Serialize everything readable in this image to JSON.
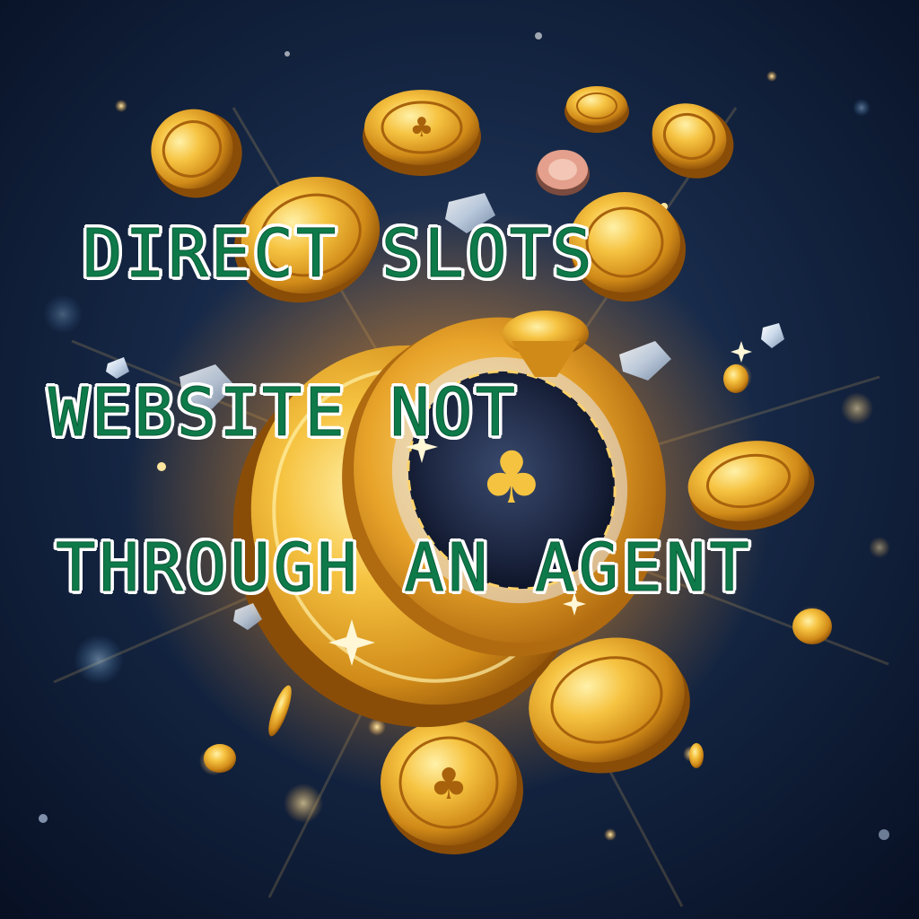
{
  "headline": {
    "line1": "DIRECT SLOTS",
    "line2": "WEBSITE NOT",
    "line3": "THROUGH AN AGENT"
  },
  "colors": {
    "text_fill": "#0e7a4a",
    "text_outline": "#ffffff",
    "background_dark": "#0b1730",
    "coin_gold": "#f2b631",
    "coin_shadow": "#a8620c",
    "chip_dark": "#1c2640"
  },
  "artwork": {
    "subject": "exploding gold coins and casino chip",
    "icons": [
      "gold-coin-icon",
      "casino-chip-icon",
      "clover-emblem-icon",
      "diamond-gem-icon",
      "sparkle-icon"
    ]
  }
}
